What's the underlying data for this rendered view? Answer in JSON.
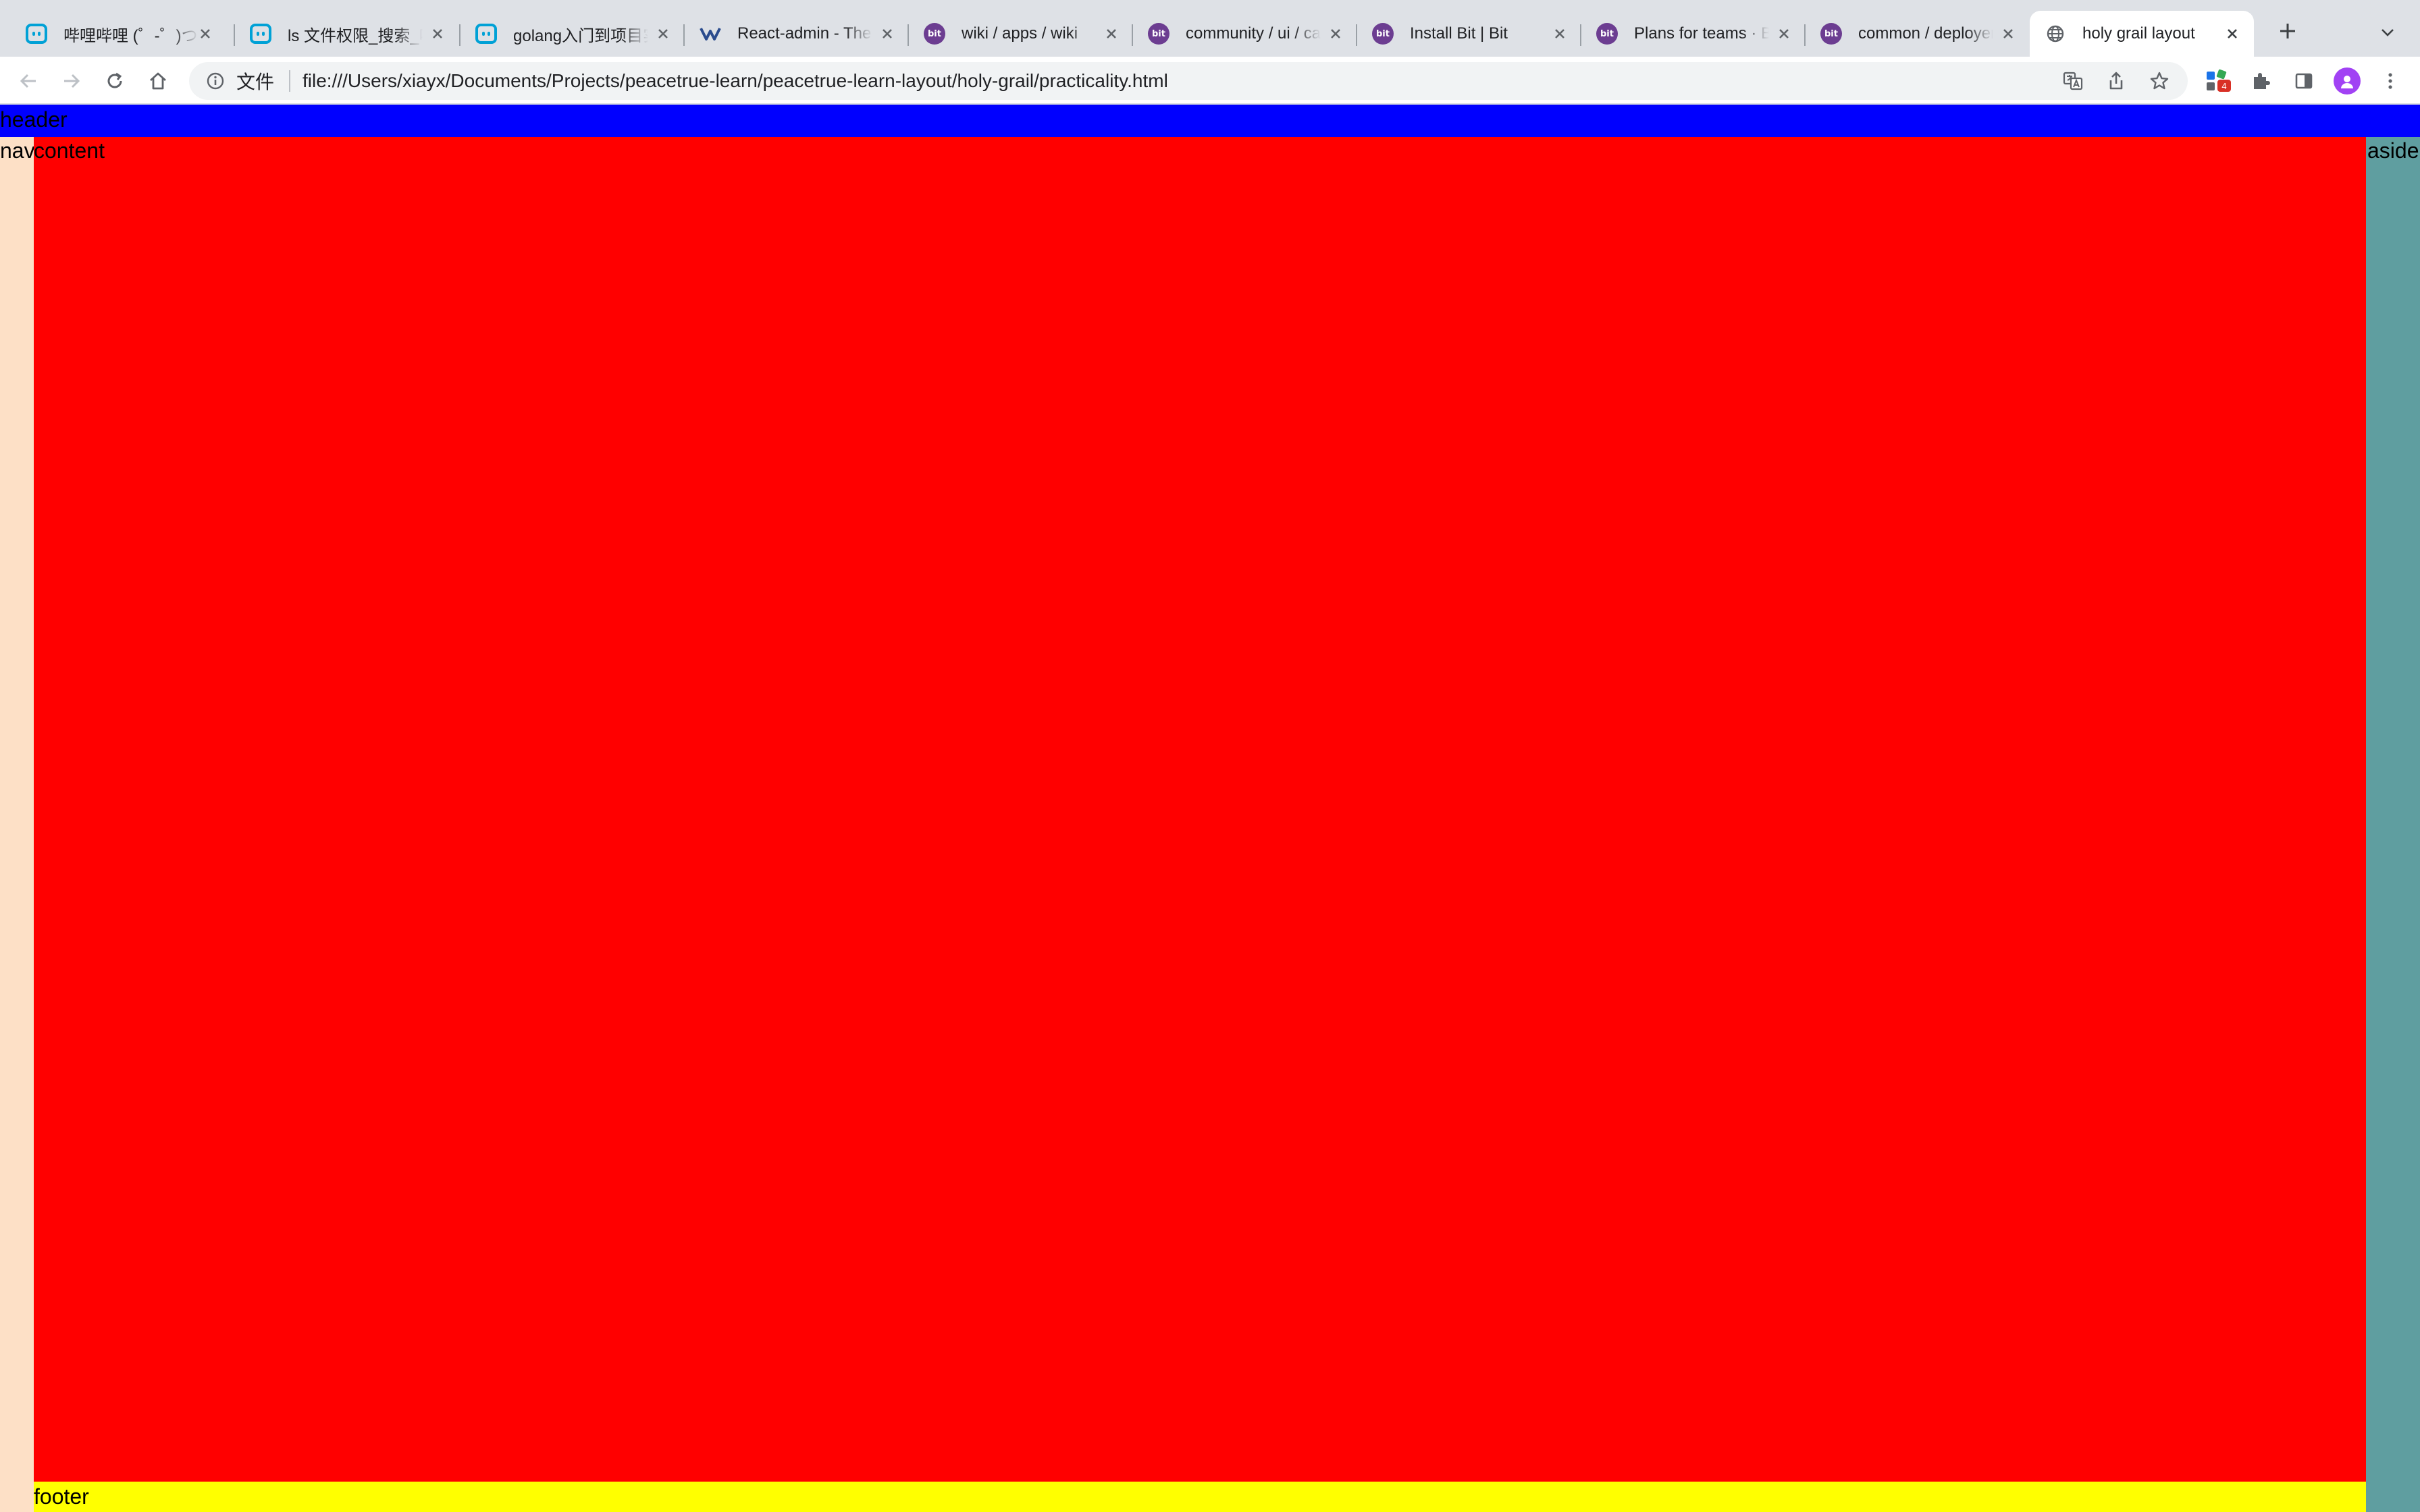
{
  "browser": {
    "tabs": [
      {
        "title": "哔哩哔哩 (゜-゜)つロ",
        "favicon": "bilibili-icon",
        "active": false
      },
      {
        "title": "ls 文件权限_搜索_哔哩哔哩",
        "favicon": "bilibili-icon",
        "active": false
      },
      {
        "title": "golang入门到项目实战",
        "favicon": "bilibili-icon",
        "active": false
      },
      {
        "title": "React-admin - The Open",
        "favicon": "react-admin-icon",
        "active": false
      },
      {
        "title": "wiki / apps / wiki",
        "favicon": "bit-icon",
        "active": false
      },
      {
        "title": "community / ui / card",
        "favicon": "bit-icon",
        "active": false
      },
      {
        "title": "Install Bit | Bit",
        "favicon": "bit-icon",
        "active": false
      },
      {
        "title": "Plans for teams · Bit",
        "favicon": "bit-icon",
        "active": false
      },
      {
        "title": "common / deployers",
        "favicon": "bit-icon",
        "active": false
      },
      {
        "title": "holy grail layout",
        "favicon": "globe-icon",
        "active": true
      }
    ],
    "bit_favicon_text": "bit",
    "omnibox": {
      "scheme_label": "文件",
      "url": "file:///Users/xiayx/Documents/Projects/peacetrue-learn/peacetrue-learn-layout/holy-grail/practicality.html"
    },
    "extensions_badge": "4"
  },
  "page": {
    "header": "header",
    "nav": "nav",
    "content": "content",
    "aside": "aside",
    "footer": "footer"
  },
  "colors": {
    "header": "#0000ff",
    "nav": "#fde0c6",
    "content": "#ff0000",
    "aside": "#5f9ea0",
    "footer": "#ffff00"
  }
}
